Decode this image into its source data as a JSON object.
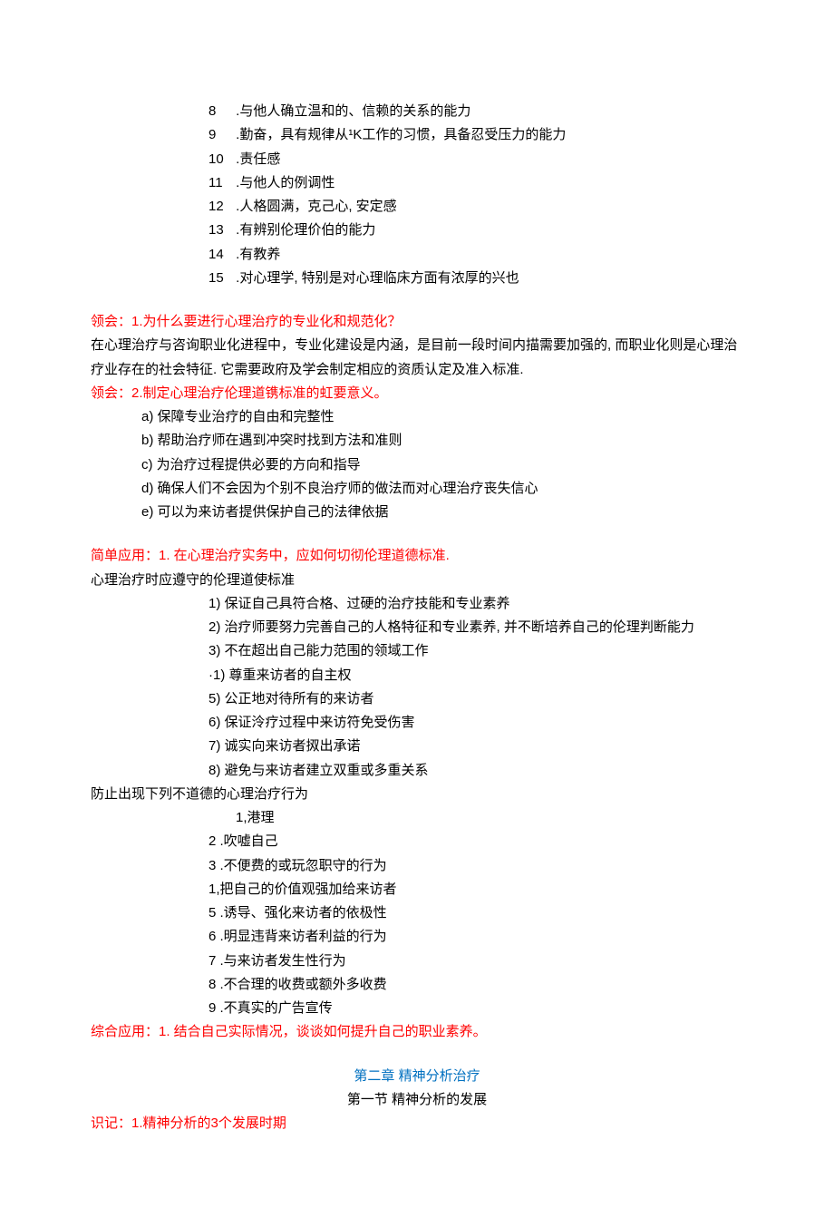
{
  "topList": [
    {
      "n": "8",
      "t": " .与他人确立温和的、信赖的关系的能力"
    },
    {
      "n": "9",
      "t": " .勤奋，具有规律从¹K工作的习惯，具备忍受压力的能力"
    },
    {
      "n": "10",
      "t": " .责任感"
    },
    {
      "n": "11",
      "t": " .与他人的例调性"
    },
    {
      "n": "12",
      "t": " .人格圆满，克己心, 安定感"
    },
    {
      "n": "13",
      "t": " .有辨别伦理价伯的能力"
    },
    {
      "n": "14",
      "t": " .有教养"
    },
    {
      "n": "15",
      "t": " .对心理学, 特别是对心理临床方面有浓厚的兴也"
    }
  ],
  "redHeading1": "领会：1.为什么要进行心理治疗的专业化和规范化？",
  "para1": "在心理治疗与咨询职业化进程中，专业化建设是内涵，是目前一段时间内描需要加强的, 而职业化则是心理治疗业存在的社会特征. 它需要政府及学会制定相应的资质认定及准入标准.",
  "redHeading2": "领会：2.制定心理治疗伦理道镌标准的虹要意义。",
  "list_a": [
    "a) 保障专业治疗的自由和完整性",
    "b) 帮助治疗师在遇到冲突时找到方法和准则",
    "c) 为治疗过程提供必要的方向和指导",
    "d) 确保人们不会因为个别不良治疗师的做法而对心理治疗丧失信心",
    "e) 可以为来访者提供保护自己的法律依据"
  ],
  "redHeading3": "简单应用：1. 在心理治疗实务中，应如何切彻伦理道德标准.",
  "para2": "心理治疗时应遵守的伦理道使标准",
  "list_b": [
    "1) 保证自己具符合格、过硬的治疗技能和专业素养",
    "2) 治疗师要努力完善自己的人格特征和专业素养, 并不断培养自己的伦理判断能力",
    "3) 不在超出自己能力范围的领域工作",
    "·1) 尊重来访者的自主权",
    "5) 公正地对待所有的来访者",
    "6) 保证泠疗过程中来访符免受伤害",
    "7) 诚实向来访者㧐出承诺",
    "8) 避免与来访者建立双重或多重关系"
  ],
  "para3": "防止出现下列不道德的心理治疗行为",
  "list_c": [
    {
      "n": "1,港理",
      "indentExtra": true
    },
    {
      "n": "2   .吹嘘自己"
    },
    {
      "n": "3   .不便费的或玩忽职守的行为"
    },
    {
      "n": "1,把自己的价值观强加给来访者"
    },
    {
      "n": "5   .诱导、强化来访者的依极性"
    },
    {
      "n": "6   .明显违背来访者利益的行为"
    },
    {
      "n": "7   .与来访者发生性行为"
    },
    {
      "n": "8   .不合理的收费或额外多收费"
    },
    {
      "n": "9   .不真实的广告宣传"
    }
  ],
  "redHeading4": "综合应用：1. 结合自己实际情况，谈谈如何提升自己的职业素养。",
  "blueHeading": "第二章 精神分析治疗",
  "centerHeading": "第一节 精神分析的发展",
  "redHeading5": "识记：1.精神分析的3个发展时期"
}
